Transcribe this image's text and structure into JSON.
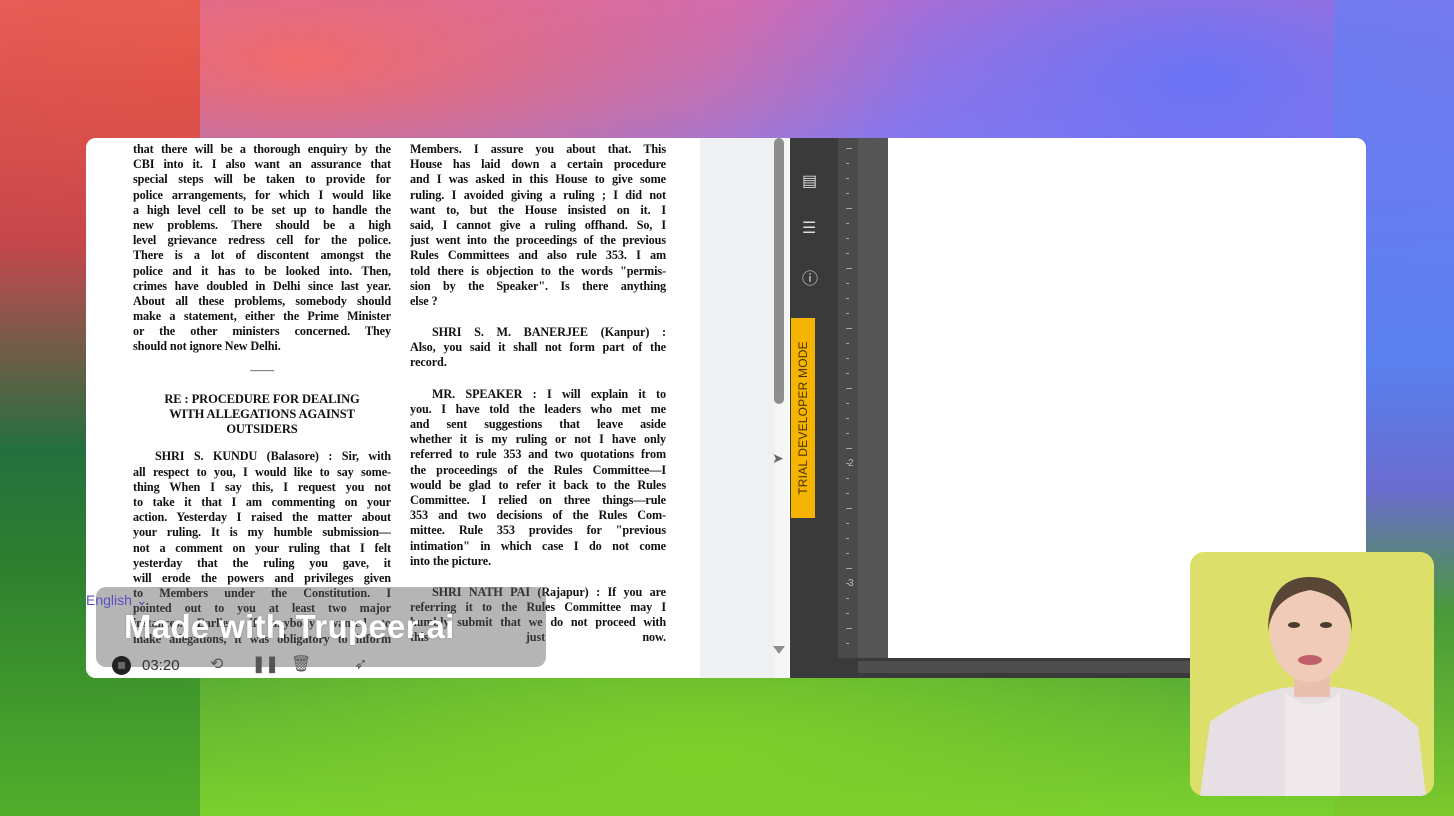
{
  "document": {
    "left_column": {
      "lines_top": [
        "that there will be a thorough enquiry by the",
        "CBI into it.  I also want an assurance that",
        "special steps will be taken to provide for",
        "police arrangements, for which I would like",
        "a high level cell to be set up to handle the",
        "new problems. There should be a high",
        "level grievance redress cell for the police.",
        "There is a lot of discontent amongst the",
        "police and it has to be looked into. Then,",
        "crimes have doubled in Delhi since last year.",
        "About all these problems, somebody should",
        "make a statement, either the Prime Minister",
        "or the other ministers concerned. They",
        "should not ignore New Delhi."
      ],
      "separator": "———",
      "heading": [
        "RE : PROCEDURE FOR DEALING",
        "WITH ALLEGATIONS AGAINST",
        "OUTSIDERS"
      ],
      "lines_bottom": [
        "SHRI S. KUNDU (Balasore) : Sir, with",
        "all respect to you, I would like to say some-",
        "thing  When I say this, I request you not",
        "to take it that I am commenting on your",
        "action. Yesterday I raised the matter about",
        "your ruling. It is my humble submission—",
        "not a comment on your ruling that I felt",
        "yesterday that the ruling you gave, it",
        "will erode the powers and privileges given",
        "to Members under the Constitution. I",
        "pointed out to you at least two major",
        "instances. Earlier, if anybody wanted to",
        "make allegations, it was obligatory to inform"
      ]
    },
    "right_column": {
      "p1": [
        "Members. I assure you about that. This",
        "House has laid down a certain procedure",
        "and I was asked in this House to give some",
        "ruling. I avoided giving a ruling ; I did not",
        "want to, but the House insisted on it. I",
        "said, I cannot give a ruling offhand. So, I",
        "just went into the proceedings of the previous",
        "Rules Committees and also rule 353. I am",
        "told there is objection to the words \"permis-",
        "sion by the Speaker\". Is there anything",
        "else ?"
      ],
      "p2": [
        "SHRI S. M. BANERJEE (Kanpur) :",
        "Also, you said it shall not form part of the",
        "record."
      ],
      "p3": [
        "MR. SPEAKER : I will explain it to",
        "you. I have told the leaders who met me",
        "and sent suggestions that leave aside",
        "whether it is my ruling or not I have only",
        "referred to rule 353 and two quotations from",
        "the proceedings of the Rules Committee—I",
        "would be glad to refer it back to the Rules",
        "Committee. I relied on three things—rule",
        "353 and two decisions of the Rules Com-",
        "mittee. Rule 353 provides for \"previous",
        "intimation\" in which case I do not come",
        "into the picture."
      ],
      "p4": [
        "SHRI NATH PAI (Rajapur) : If you are",
        "referring it to the Rules Committee may I",
        "humbly submit that we do not proceed with",
        "this just now."
      ]
    }
  },
  "sidebar": {
    "trial_badge": "TRIAL DEVELOPER MODE",
    "icons": [
      "comment-icon",
      "list-icon",
      "info-icon"
    ]
  },
  "ruler": {
    "numbers": [
      "2",
      "3"
    ]
  },
  "recorder": {
    "language": "English",
    "language_chevron": "⌄",
    "branding": "Made with Trupeer.ai",
    "elapsed": "03:20"
  },
  "colors": {
    "trial": "#f5b400",
    "camera_bg": "#dcdf6a",
    "dark_panel": "#3a3a3a"
  }
}
